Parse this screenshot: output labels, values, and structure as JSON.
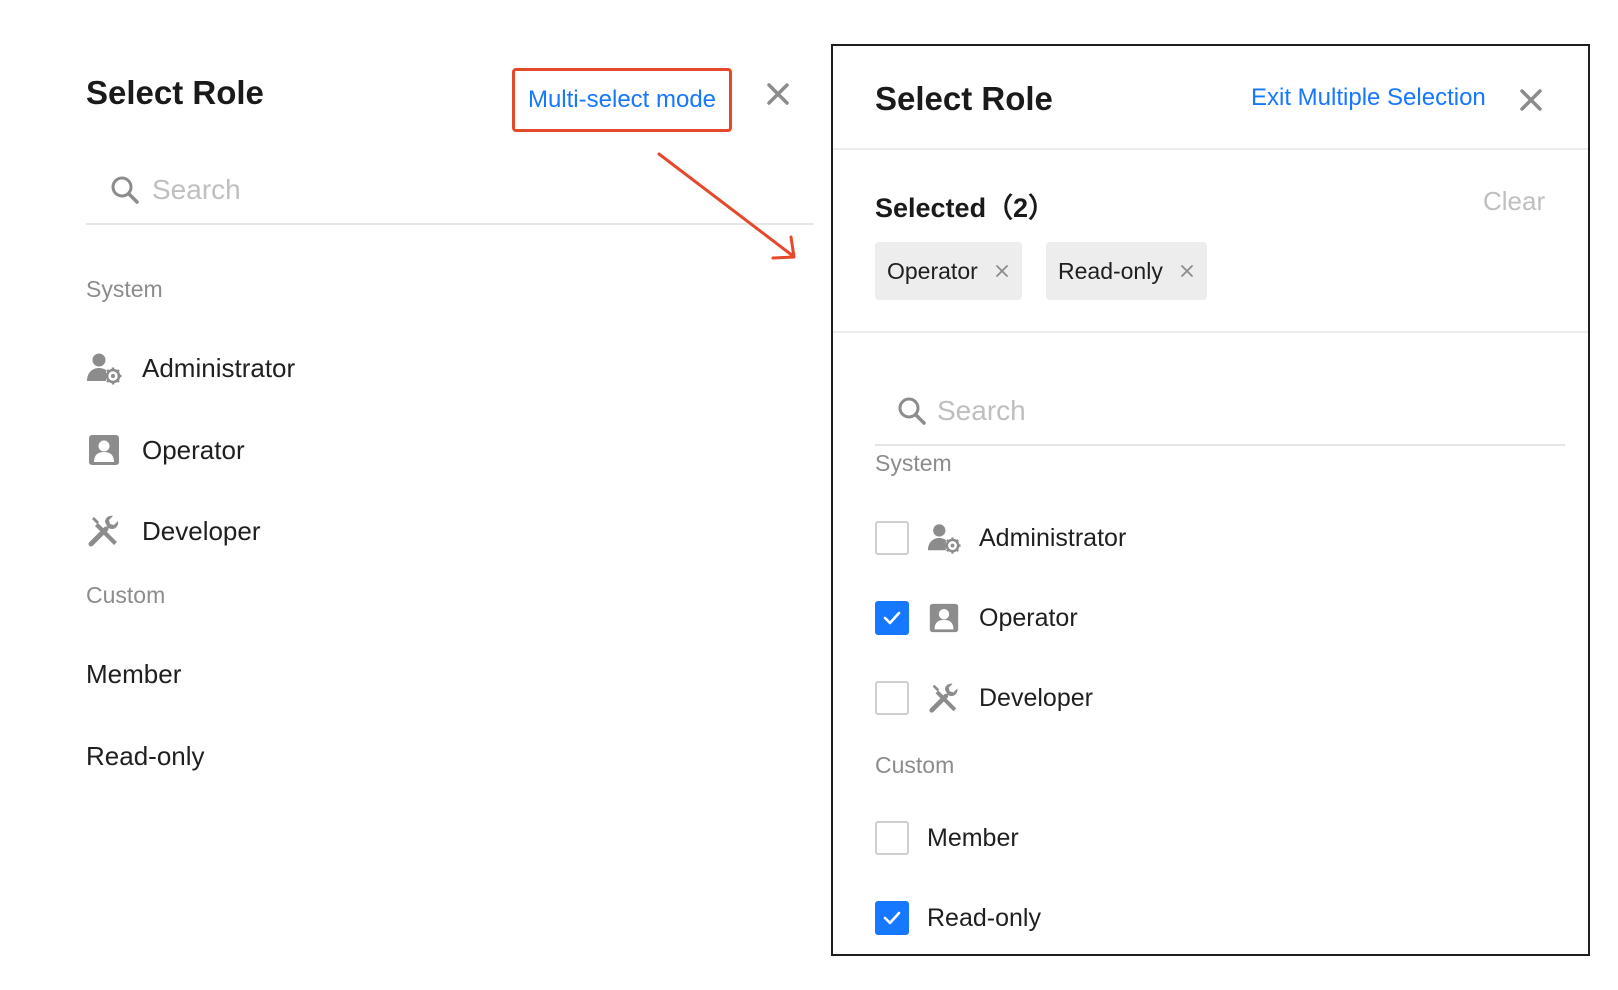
{
  "colors": {
    "accent": "#1677ff",
    "highlight_border": "#e5492a",
    "muted_text": "#8c8c8c",
    "placeholder": "#bfbfbf",
    "icon_gray": "#8c8c8c",
    "tag_bg": "#ededed"
  },
  "left_panel": {
    "title": "Select Role",
    "multi_select_label": "Multi-select mode",
    "search": {
      "placeholder": "Search",
      "value": ""
    },
    "groups": {
      "system_label": "System",
      "custom_label": "Custom"
    },
    "items": [
      {
        "label": "Administrator",
        "icon": "user-gear-icon"
      },
      {
        "label": "Operator",
        "icon": "user-card-icon"
      },
      {
        "label": "Developer",
        "icon": "tools-icon"
      },
      {
        "label": "Member",
        "icon": ""
      },
      {
        "label": "Read-only",
        "icon": ""
      }
    ]
  },
  "right_panel": {
    "title": "Select Role",
    "exit_label": "Exit Multiple Selection",
    "selected_label": "Selected（2）",
    "clear_label": "Clear",
    "tags": [
      {
        "label": "Operator"
      },
      {
        "label": "Read-only"
      }
    ],
    "search": {
      "placeholder": "Search",
      "value": ""
    },
    "groups": {
      "system_label": "System",
      "custom_label": "Custom"
    },
    "items": [
      {
        "label": "Administrator",
        "icon": "user-gear-icon",
        "checked": false
      },
      {
        "label": "Operator",
        "icon": "user-card-icon",
        "checked": true
      },
      {
        "label": "Developer",
        "icon": "tools-icon",
        "checked": false
      },
      {
        "label": "Member",
        "icon": "",
        "checked": false
      },
      {
        "label": "Read-only",
        "icon": "",
        "checked": true
      }
    ]
  }
}
